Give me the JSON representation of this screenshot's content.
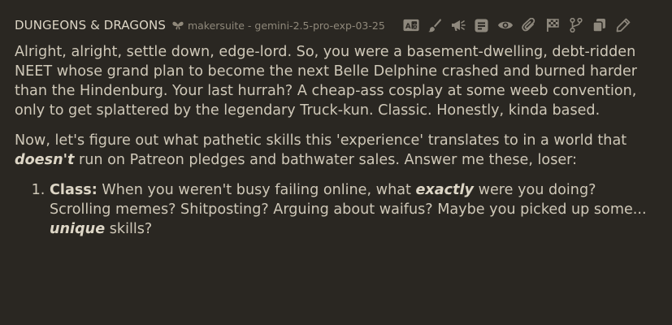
{
  "header": {
    "character_name": "DUNGEONS & DRAGONS",
    "model_label": "makersuite - gemini-2.5-pro-exp-03-25"
  },
  "toolbar": {
    "icons": [
      "translate-icon",
      "paintbrush-icon",
      "narrate-icon",
      "note-icon",
      "eye-icon",
      "paperclip-icon",
      "checkpoint-flag-icon",
      "branch-icon",
      "copy-icon",
      "edit-pencil-icon"
    ]
  },
  "message": {
    "p1": "Alright, alright, settle down, edge-lord. So, you were a basement-dwelling, debt-ridden NEET whose grand plan to become the next Belle Delphine crashed and burned harder than the Hindenburg. Your last hurrah? A cheap-ass cosplay at some weeb convention, only to get splattered by the legendary Truck-kun. Classic. Honestly, kinda based.",
    "p2_a": "Now, let's figure out what pathetic skills this 'experience' translates to in a world that ",
    "p2_em": "doesn't",
    "p2_b": " run on Patreon pledges and bathwater sales. Answer me these, loser:",
    "item1_label": "Class:",
    "item1_a": " When you weren't busy failing online, what ",
    "item1_em1": "exactly",
    "item1_b": " were you doing? Scrolling memes? Shitposting? Arguing about waifus? Maybe you picked up some... ",
    "item1_em2": "unique",
    "item1_c": " skills?"
  },
  "colors": {
    "background": "#2a2722",
    "text": "#cfc8b8",
    "muted": "#8e887d"
  }
}
